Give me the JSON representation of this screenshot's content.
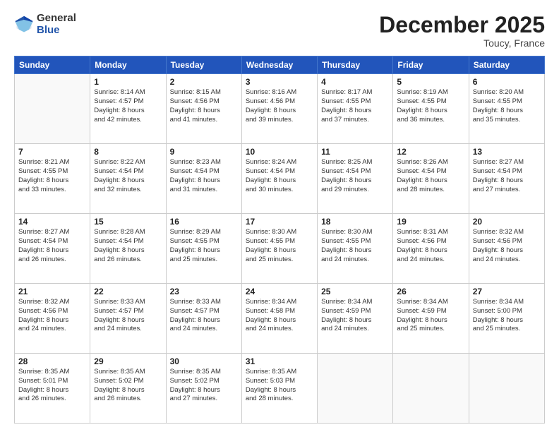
{
  "header": {
    "logo_general": "General",
    "logo_blue": "Blue",
    "month_title": "December 2025",
    "location": "Toucy, France"
  },
  "days_of_week": [
    "Sunday",
    "Monday",
    "Tuesday",
    "Wednesday",
    "Thursday",
    "Friday",
    "Saturday"
  ],
  "weeks": [
    [
      {
        "day": "",
        "info": ""
      },
      {
        "day": "1",
        "info": "Sunrise: 8:14 AM\nSunset: 4:57 PM\nDaylight: 8 hours\nand 42 minutes."
      },
      {
        "day": "2",
        "info": "Sunrise: 8:15 AM\nSunset: 4:56 PM\nDaylight: 8 hours\nand 41 minutes."
      },
      {
        "day": "3",
        "info": "Sunrise: 8:16 AM\nSunset: 4:56 PM\nDaylight: 8 hours\nand 39 minutes."
      },
      {
        "day": "4",
        "info": "Sunrise: 8:17 AM\nSunset: 4:55 PM\nDaylight: 8 hours\nand 37 minutes."
      },
      {
        "day": "5",
        "info": "Sunrise: 8:19 AM\nSunset: 4:55 PM\nDaylight: 8 hours\nand 36 minutes."
      },
      {
        "day": "6",
        "info": "Sunrise: 8:20 AM\nSunset: 4:55 PM\nDaylight: 8 hours\nand 35 minutes."
      }
    ],
    [
      {
        "day": "7",
        "info": "Sunrise: 8:21 AM\nSunset: 4:55 PM\nDaylight: 8 hours\nand 33 minutes."
      },
      {
        "day": "8",
        "info": "Sunrise: 8:22 AM\nSunset: 4:54 PM\nDaylight: 8 hours\nand 32 minutes."
      },
      {
        "day": "9",
        "info": "Sunrise: 8:23 AM\nSunset: 4:54 PM\nDaylight: 8 hours\nand 31 minutes."
      },
      {
        "day": "10",
        "info": "Sunrise: 8:24 AM\nSunset: 4:54 PM\nDaylight: 8 hours\nand 30 minutes."
      },
      {
        "day": "11",
        "info": "Sunrise: 8:25 AM\nSunset: 4:54 PM\nDaylight: 8 hours\nand 29 minutes."
      },
      {
        "day": "12",
        "info": "Sunrise: 8:26 AM\nSunset: 4:54 PM\nDaylight: 8 hours\nand 28 minutes."
      },
      {
        "day": "13",
        "info": "Sunrise: 8:27 AM\nSunset: 4:54 PM\nDaylight: 8 hours\nand 27 minutes."
      }
    ],
    [
      {
        "day": "14",
        "info": "Sunrise: 8:27 AM\nSunset: 4:54 PM\nDaylight: 8 hours\nand 26 minutes."
      },
      {
        "day": "15",
        "info": "Sunrise: 8:28 AM\nSunset: 4:54 PM\nDaylight: 8 hours\nand 26 minutes."
      },
      {
        "day": "16",
        "info": "Sunrise: 8:29 AM\nSunset: 4:55 PM\nDaylight: 8 hours\nand 25 minutes."
      },
      {
        "day": "17",
        "info": "Sunrise: 8:30 AM\nSunset: 4:55 PM\nDaylight: 8 hours\nand 25 minutes."
      },
      {
        "day": "18",
        "info": "Sunrise: 8:30 AM\nSunset: 4:55 PM\nDaylight: 8 hours\nand 24 minutes."
      },
      {
        "day": "19",
        "info": "Sunrise: 8:31 AM\nSunset: 4:56 PM\nDaylight: 8 hours\nand 24 minutes."
      },
      {
        "day": "20",
        "info": "Sunrise: 8:32 AM\nSunset: 4:56 PM\nDaylight: 8 hours\nand 24 minutes."
      }
    ],
    [
      {
        "day": "21",
        "info": "Sunrise: 8:32 AM\nSunset: 4:56 PM\nDaylight: 8 hours\nand 24 minutes."
      },
      {
        "day": "22",
        "info": "Sunrise: 8:33 AM\nSunset: 4:57 PM\nDaylight: 8 hours\nand 24 minutes."
      },
      {
        "day": "23",
        "info": "Sunrise: 8:33 AM\nSunset: 4:57 PM\nDaylight: 8 hours\nand 24 minutes."
      },
      {
        "day": "24",
        "info": "Sunrise: 8:34 AM\nSunset: 4:58 PM\nDaylight: 8 hours\nand 24 minutes."
      },
      {
        "day": "25",
        "info": "Sunrise: 8:34 AM\nSunset: 4:59 PM\nDaylight: 8 hours\nand 24 minutes."
      },
      {
        "day": "26",
        "info": "Sunrise: 8:34 AM\nSunset: 4:59 PM\nDaylight: 8 hours\nand 25 minutes."
      },
      {
        "day": "27",
        "info": "Sunrise: 8:34 AM\nSunset: 5:00 PM\nDaylight: 8 hours\nand 25 minutes."
      }
    ],
    [
      {
        "day": "28",
        "info": "Sunrise: 8:35 AM\nSunset: 5:01 PM\nDaylight: 8 hours\nand 26 minutes."
      },
      {
        "day": "29",
        "info": "Sunrise: 8:35 AM\nSunset: 5:02 PM\nDaylight: 8 hours\nand 26 minutes."
      },
      {
        "day": "30",
        "info": "Sunrise: 8:35 AM\nSunset: 5:02 PM\nDaylight: 8 hours\nand 27 minutes."
      },
      {
        "day": "31",
        "info": "Sunrise: 8:35 AM\nSunset: 5:03 PM\nDaylight: 8 hours\nand 28 minutes."
      },
      {
        "day": "",
        "info": ""
      },
      {
        "day": "",
        "info": ""
      },
      {
        "day": "",
        "info": ""
      }
    ]
  ]
}
